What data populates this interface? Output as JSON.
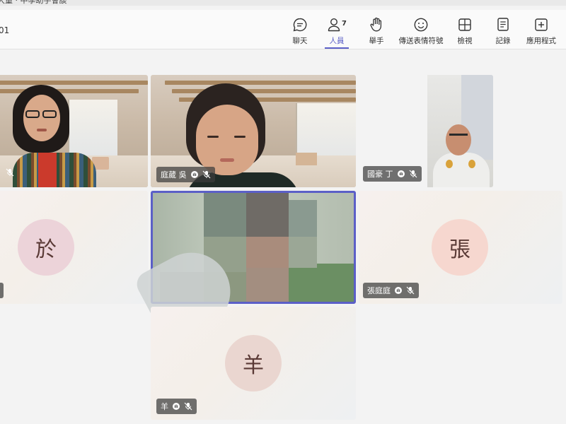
{
  "window": {
    "title_fragment": "大量 · 中學助手會談",
    "more_label": "···"
  },
  "toolbar": {
    "left_text": "01",
    "items": [
      {
        "label": "聊天",
        "icon": "chat-icon"
      },
      {
        "label": "人員",
        "icon": "people-icon",
        "count": "7",
        "active": true
      },
      {
        "label": "舉手",
        "icon": "raise-hand-icon"
      },
      {
        "label": "傳送表情符號",
        "icon": "emoji-icon"
      },
      {
        "label": "檢視",
        "icon": "grid-view-icon"
      },
      {
        "label": "記錄",
        "icon": "notes-icon"
      },
      {
        "label": "應用程式",
        "icon": "add-app-icon"
      }
    ]
  },
  "participants": [
    {
      "name": "",
      "type": "video",
      "muted": true
    },
    {
      "name": "庭葳 吳",
      "type": "video",
      "muted": true,
      "hand_icon": true
    },
    {
      "name": "國豪 丁",
      "type": "video",
      "muted": true,
      "hand_icon": true
    },
    {
      "name": "",
      "initial": "於",
      "type": "avatar"
    },
    {
      "name": "",
      "type": "video-blurred",
      "active_speaker": true
    },
    {
      "name": "張庭庭",
      "initial": "張",
      "type": "avatar",
      "muted": true,
      "hand_icon": true
    },
    {
      "name": "羊",
      "initial": "羊",
      "type": "avatar",
      "muted": true,
      "hand_icon": true
    }
  ],
  "colors": {
    "accent": "#5b5fc7",
    "avatar_1_bg": "#ecd3d9",
    "avatar_2_bg": "#f6d7cf",
    "avatar_3_bg": "#ead6d0"
  }
}
